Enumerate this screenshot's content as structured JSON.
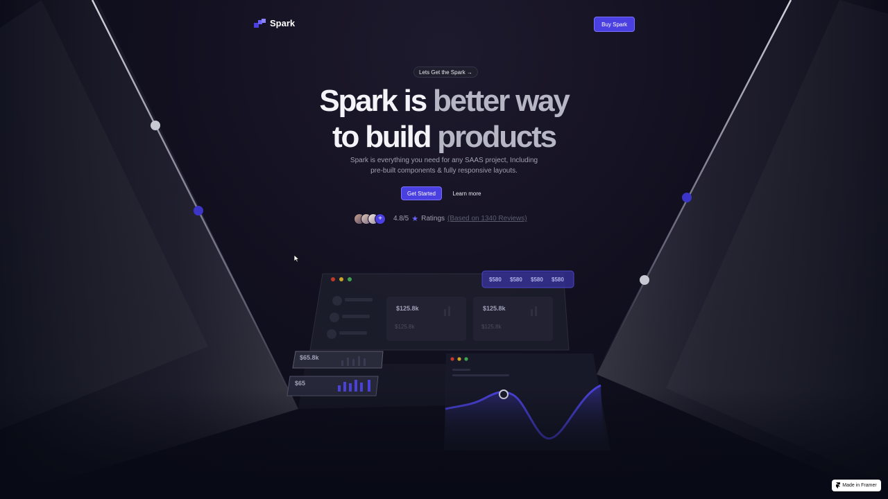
{
  "brand": {
    "name": "Spark",
    "accent": "#4a3fe0"
  },
  "nav": {
    "buy_label": "Buy Spark"
  },
  "hero": {
    "pill": "Lets Get the Spark →",
    "title_line1_white": "Spark is",
    "title_line1_grey": " better way",
    "title_line2_white": "to build",
    "title_line2_grey": " products",
    "subtitle_line1": "Spark is everything you need for any SAAS project, Including",
    "subtitle_line2": "pre-built components & fully responsive layouts.",
    "primary_cta": "Get Started",
    "secondary_cta": "Learn more",
    "avatar_plus": "+",
    "rating": "4.8/5",
    "star": "★",
    "rating_label": "Ratings",
    "reviews": "(Based on 1340 Reviews)"
  },
  "dashboard": {
    "chips": [
      "$580",
      "$580",
      "$580",
      "$580"
    ],
    "card_values": [
      "$125.8k",
      "$125.8k"
    ],
    "card_values_faded": [
      "$125.8k",
      "$125.8k"
    ],
    "mini_card_1": "$65.8k",
    "mini_card_2": "$65"
  },
  "footer": {
    "badge": "Made in Framer"
  }
}
